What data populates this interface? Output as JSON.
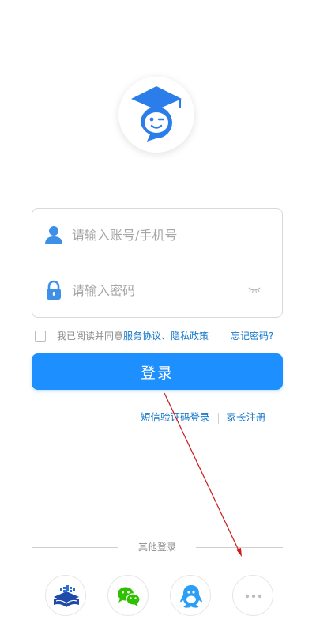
{
  "login": {
    "account_placeholder": "请输入账号/手机号",
    "password_placeholder": "请输入密码",
    "button_label": "登录"
  },
  "agreement": {
    "prefix": "我已阅读并同意",
    "terms_link": "服务协议",
    "separator": "、",
    "privacy_link": "隐私政策",
    "forgot_link": "忘记密码?"
  },
  "secondary": {
    "sms_login": "短信验证码登录",
    "parent_register": "家长注册"
  },
  "other_login": {
    "label": "其他登录",
    "options": [
      {
        "icon": "school-book-icon"
      },
      {
        "icon": "wechat-icon"
      },
      {
        "icon": "qq-icon"
      },
      {
        "icon": "more-icon"
      }
    ]
  },
  "colors": {
    "primary": "#1e8fff",
    "link": "#1677c9",
    "logo_blue": "#2b7de9",
    "wechat_green": "#2dc100",
    "qq_blue": "#2a9ff5",
    "annotation_red": "#cc1a1a"
  }
}
